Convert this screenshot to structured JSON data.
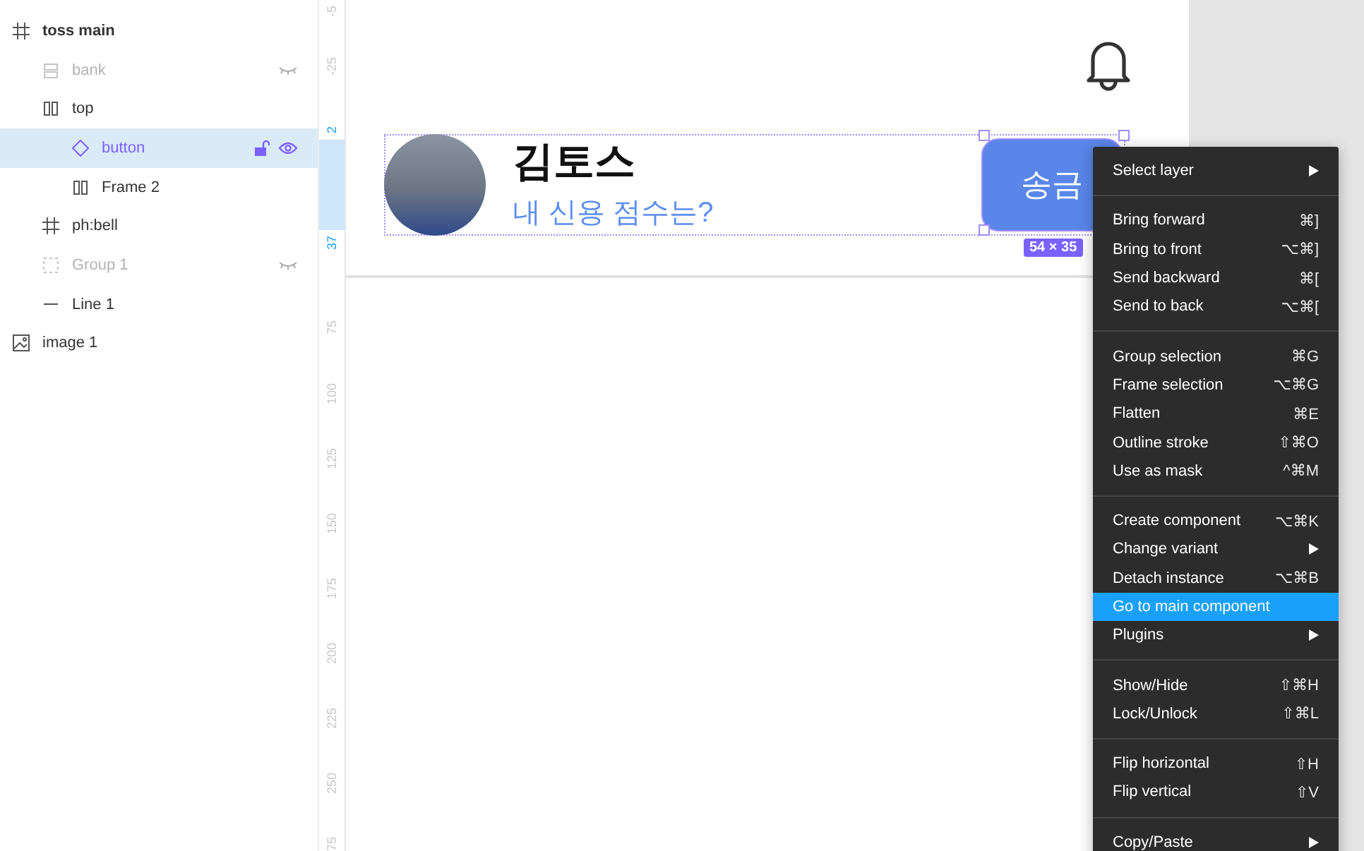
{
  "layers": [
    {
      "name": "toss main",
      "kind": "frame",
      "hidden": false,
      "selected": false,
      "children": [
        {
          "name": "bank",
          "kind": "stack-vertical",
          "hidden": true,
          "selected": false
        },
        {
          "name": "top",
          "kind": "stack-horizontal",
          "hidden": false,
          "selected": false,
          "children": [
            {
              "name": "button",
              "kind": "component",
              "hidden": false,
              "selected": true
            },
            {
              "name": "Frame 2",
              "kind": "stack-horizontal",
              "hidden": false,
              "selected": false
            }
          ]
        },
        {
          "name": "ph:bell",
          "kind": "frame",
          "hidden": false,
          "selected": false
        },
        {
          "name": "Group 1",
          "kind": "group",
          "hidden": true,
          "selected": false
        },
        {
          "name": "Line 1",
          "kind": "line",
          "hidden": false,
          "selected": false
        }
      ]
    },
    {
      "name": "image 1",
      "kind": "image",
      "hidden": false,
      "selected": false
    }
  ],
  "ruler": [
    {
      "label": "-5",
      "highlighted": false
    },
    {
      "label": "-25",
      "highlighted": false
    },
    {
      "label": "2",
      "highlighted": true
    },
    {
      "label": "37",
      "highlighted": true
    },
    {
      "label": "75",
      "highlighted": false
    },
    {
      "label": "100",
      "highlighted": false
    },
    {
      "label": "125",
      "highlighted": false
    },
    {
      "label": "150",
      "highlighted": false
    },
    {
      "label": "175",
      "highlighted": false
    },
    {
      "label": "200",
      "highlighted": false
    },
    {
      "label": "225",
      "highlighted": false
    },
    {
      "label": "250",
      "highlighted": false
    },
    {
      "label": "75",
      "highlighted": false
    }
  ],
  "canvas": {
    "name": "김토스",
    "subtitle": "내 신용 점수는?",
    "button": "송금",
    "size_badge": "54 × 35"
  },
  "menu": [
    [
      {
        "label": "Select layer",
        "submenu": true,
        "selected": false
      }
    ],
    [
      {
        "label": "Bring forward",
        "shortcut": "⌘]",
        "submenu": false,
        "selected": false
      },
      {
        "label": "Bring to front",
        "shortcut": "⌥⌘]",
        "submenu": false,
        "selected": false
      },
      {
        "label": "Send backward",
        "shortcut": "⌘[",
        "submenu": false,
        "selected": false
      },
      {
        "label": "Send to back",
        "shortcut": "⌥⌘[",
        "submenu": false,
        "selected": false
      }
    ],
    [
      {
        "label": "Group selection",
        "shortcut": "⌘G",
        "submenu": false,
        "selected": false
      },
      {
        "label": "Frame selection",
        "shortcut": "⌥⌘G",
        "submenu": false,
        "selected": false
      },
      {
        "label": "Flatten",
        "shortcut": "⌘E",
        "submenu": false,
        "selected": false
      },
      {
        "label": "Outline stroke",
        "shortcut": "⇧⌘O",
        "submenu": false,
        "selected": false
      },
      {
        "label": "Use as mask",
        "shortcut": "^⌘M",
        "submenu": false,
        "selected": false
      }
    ],
    [
      {
        "label": "Create component",
        "shortcut": "⌥⌘K",
        "submenu": false,
        "selected": false
      },
      {
        "label": "Change variant",
        "submenu": true,
        "selected": false
      },
      {
        "label": "Detach instance",
        "shortcut": "⌥⌘B",
        "submenu": false,
        "selected": false
      },
      {
        "label": "Go to main component",
        "submenu": false,
        "selected": true
      },
      {
        "label": "Plugins",
        "submenu": true,
        "selected": false
      }
    ],
    [
      {
        "label": "Show/Hide",
        "shortcut": "⇧⌘H",
        "submenu": false,
        "selected": false
      },
      {
        "label": "Lock/Unlock",
        "shortcut": "⇧⌘L",
        "submenu": false,
        "selected": false
      }
    ],
    [
      {
        "label": "Flip horizontal",
        "shortcut": "⇧H",
        "submenu": false,
        "selected": false
      },
      {
        "label": "Flip vertical",
        "shortcut": "⇧V",
        "submenu": false,
        "selected": false
      }
    ],
    [
      {
        "label": "Copy/Paste",
        "submenu": true,
        "selected": false
      }
    ]
  ]
}
